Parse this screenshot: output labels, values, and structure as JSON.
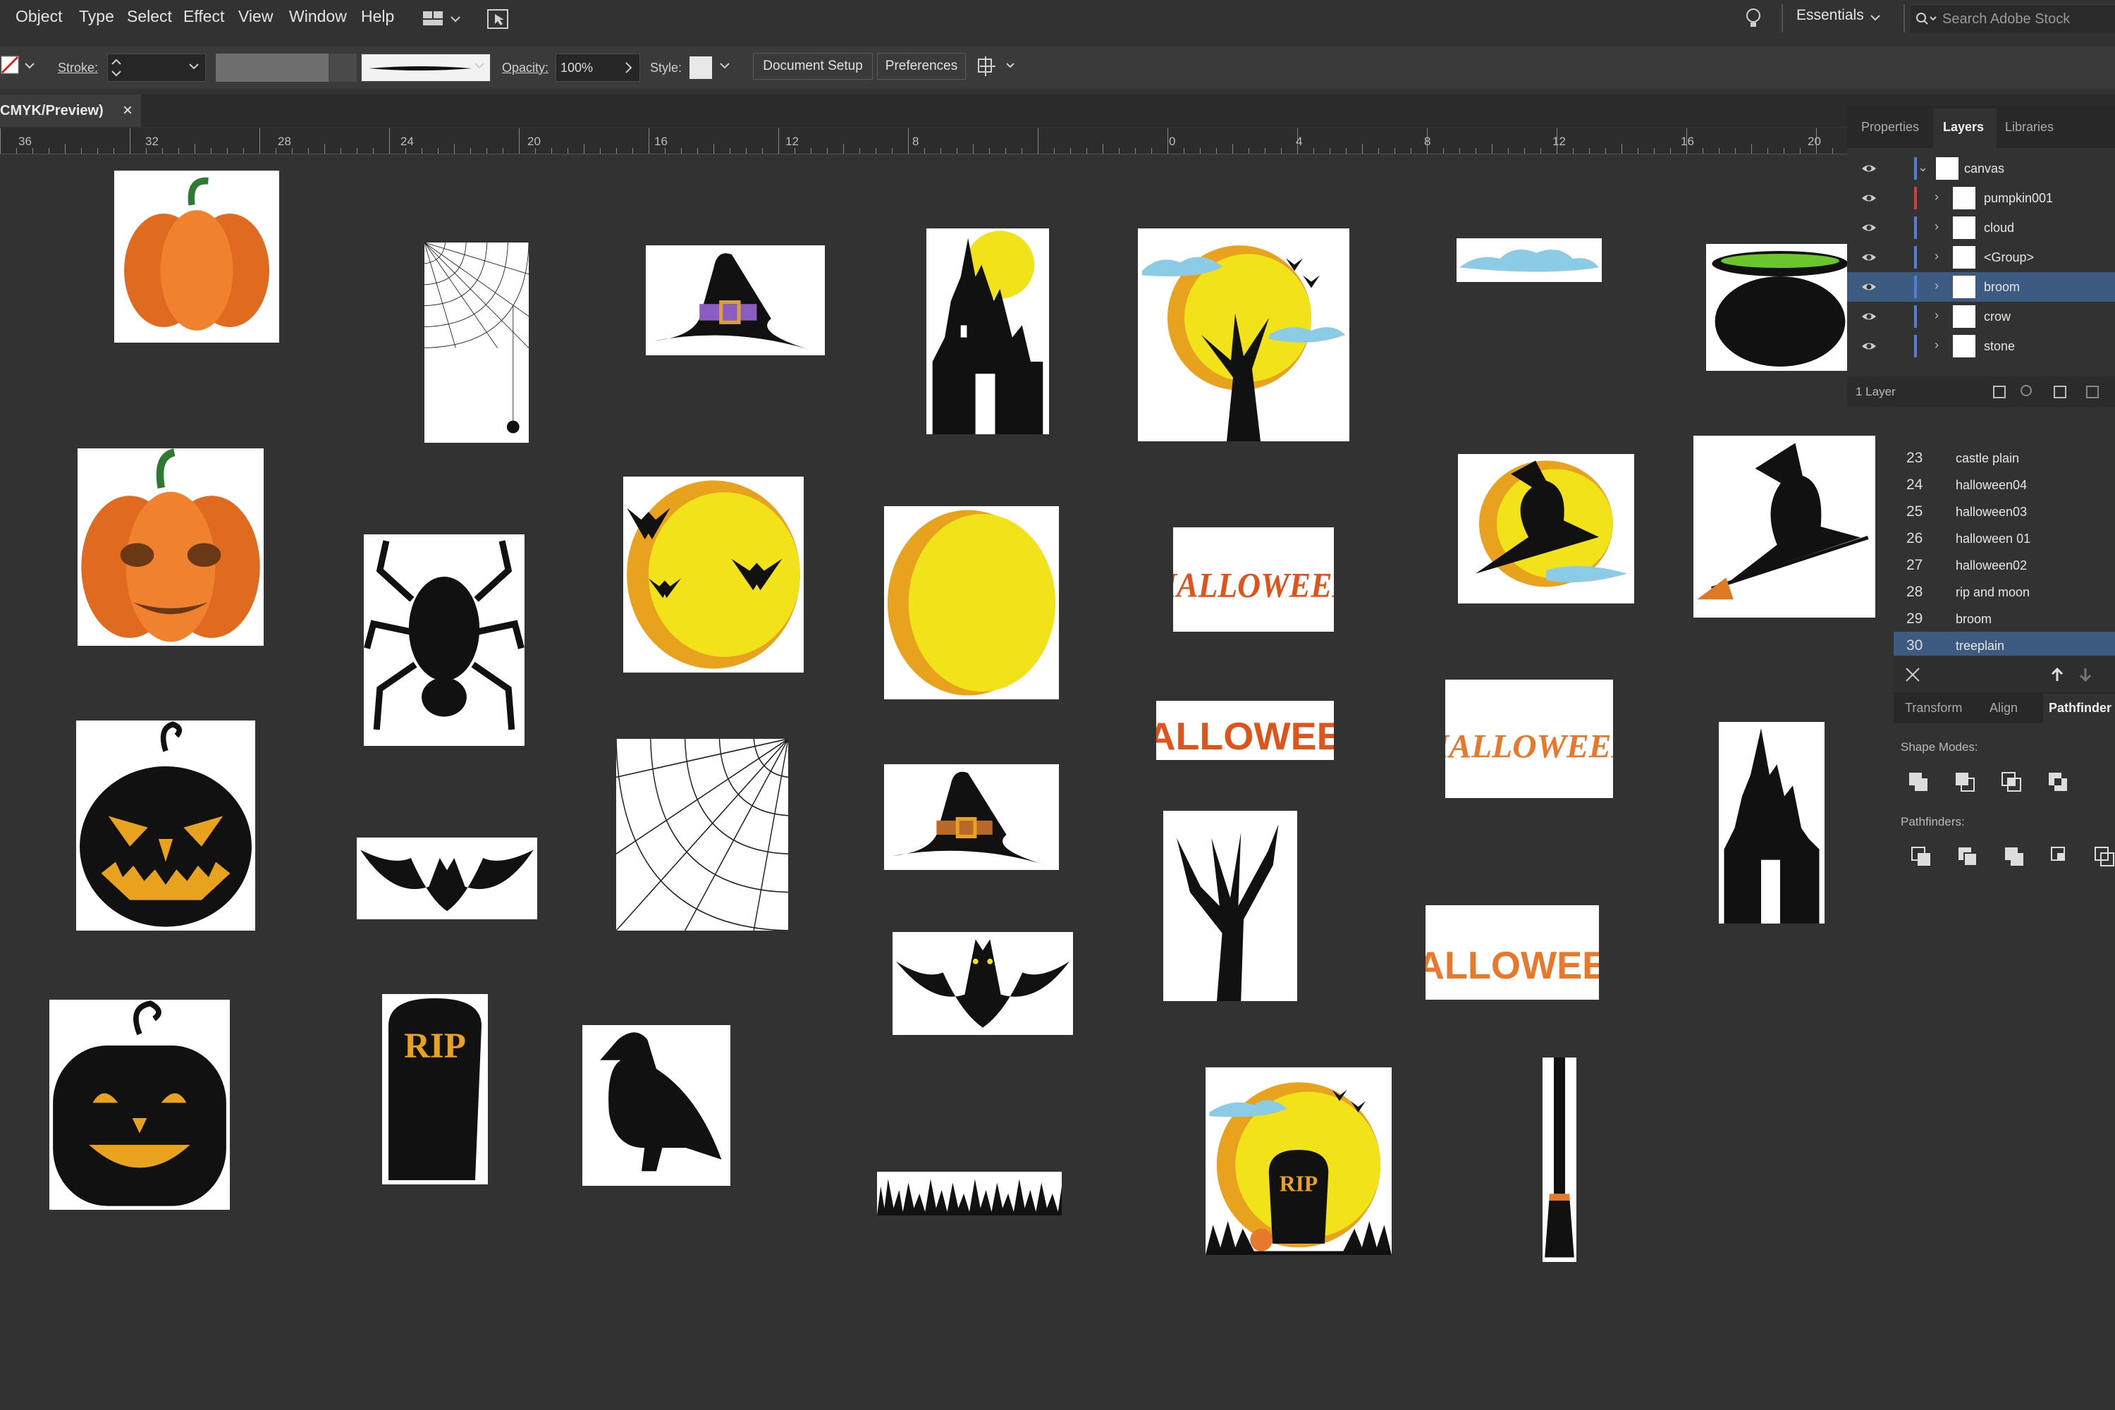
{
  "menubar": {
    "items": [
      "Object",
      "Type",
      "Select",
      "Effect",
      "View",
      "Window",
      "Help"
    ],
    "workspace": "Essentials",
    "search_placeholder": "Search Adobe Stock"
  },
  "controlbar": {
    "stroke_label": "Stroke:",
    "opacity_label": "Opacity:",
    "opacity_value": "100%",
    "style_label": "Style:",
    "document_setup": "Document Setup",
    "preferences": "Preferences"
  },
  "document_tab": {
    "title": "CMYK/Preview)",
    "close": "×"
  },
  "ruler": {
    "labels": [
      "36",
      "32",
      "28",
      "24",
      "20",
      "16",
      "12",
      "8",
      "0",
      "4",
      "8",
      "12",
      "16",
      "20"
    ]
  },
  "layers_panel": {
    "tabs": [
      "Properties",
      "Layers",
      "Libraries"
    ],
    "active_tab": "Layers",
    "rows": [
      {
        "name": "canvas",
        "top": true
      },
      {
        "name": "pumpkin001",
        "color": "#d04040"
      },
      {
        "name": "cloud",
        "color": "#4f7fd8"
      },
      {
        "name": "<Group>",
        "color": "#4f7fd8"
      },
      {
        "name": "broom",
        "color": "#4f7fd8",
        "selected": true
      },
      {
        "name": "crow",
        "color": "#4f7fd8"
      },
      {
        "name": "stone",
        "color": "#4f7fd8"
      }
    ],
    "footer": "1 Layer"
  },
  "history_panel": {
    "rows": [
      {
        "n": "23",
        "label": "castle plain"
      },
      {
        "n": "24",
        "label": "halloween04"
      },
      {
        "n": "25",
        "label": "halloween03"
      },
      {
        "n": "26",
        "label": "halloween 01"
      },
      {
        "n": "27",
        "label": "halloween02"
      },
      {
        "n": "28",
        "label": "rip and moon"
      },
      {
        "n": "29",
        "label": "broom"
      },
      {
        "n": "30",
        "label": "treeplain",
        "selected": true
      }
    ]
  },
  "pathfinder_panel": {
    "tabs": [
      "Transform",
      "Align",
      "Pathfinder"
    ],
    "active_tab": "Pathfinder",
    "shape_modes": "Shape Modes:",
    "pathfinders": "Pathfinders:"
  },
  "artwork": {
    "rip_text": "RIP",
    "halloween_text": "HALLOWEEN"
  },
  "colors": {
    "pumpkin": "#e8782a",
    "moon_yellow": "#f2e21a",
    "moon_orange": "#e8a21e",
    "halloween_orange": "#e8782a",
    "selection_blue": "#3d5a80"
  }
}
